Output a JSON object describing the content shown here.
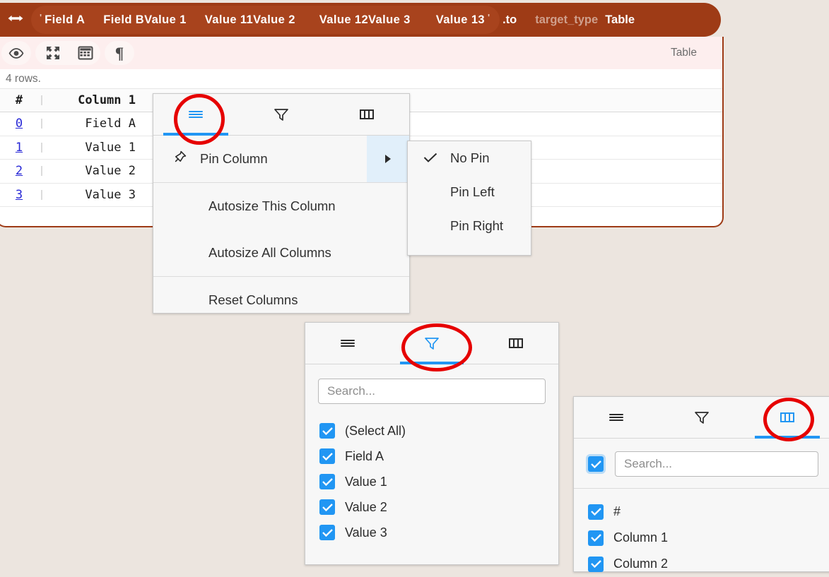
{
  "topbar": {
    "arrow_icon": "left-right-arrow-icon",
    "quote_open": "'",
    "quote_close": "'",
    "tokens": [
      "Field A",
      "Field B",
      "Value 1",
      "Value 11",
      "Value 2",
      "Value 12",
      "Value 3",
      "Value 13"
    ],
    "to_label": ".to",
    "param_name": "target_type",
    "param_value": "Table"
  },
  "toolbar": {
    "eye_icon": "eye-icon",
    "expand_icon": "expand-arrows-icon",
    "grid_icon": "table-grid-icon",
    "pilcrow_icon": "pilcrow-icon",
    "right_label": "Table"
  },
  "table": {
    "row_count_label": "4 rows.",
    "headers": [
      "#",
      "Column 1"
    ],
    "rows": [
      {
        "index": "0",
        "column1": "Field A"
      },
      {
        "index": "1",
        "column1": "Value 1"
      },
      {
        "index": "2",
        "column1": "Value 2"
      },
      {
        "index": "3",
        "column1": "Value 3"
      }
    ]
  },
  "menu_panel": {
    "tabs": [
      {
        "icon": "hamburger-menu-icon",
        "name": "general",
        "active": true
      },
      {
        "icon": "filter-funnel-icon",
        "name": "filter",
        "active": false
      },
      {
        "icon": "columns-icon",
        "name": "columns",
        "active": false
      }
    ],
    "items": [
      {
        "label": "Pin Column",
        "icon": "pin-icon",
        "has_submenu": true
      },
      {
        "label": "Autosize This Column",
        "icon": "",
        "has_submenu": false
      },
      {
        "label": "Autosize All Columns",
        "icon": "",
        "has_submenu": false
      },
      {
        "label": "Reset Columns",
        "icon": "",
        "has_submenu": false
      }
    ]
  },
  "pin_submenu": {
    "items": [
      {
        "label": "No Pin",
        "checked": true
      },
      {
        "label": "Pin Left",
        "checked": false
      },
      {
        "label": "Pin Right",
        "checked": false
      }
    ]
  },
  "filter_panel": {
    "tabs": [
      {
        "icon": "hamburger-menu-icon",
        "name": "general",
        "active": false
      },
      {
        "icon": "filter-funnel-icon",
        "name": "filter",
        "active": true
      },
      {
        "icon": "columns-icon",
        "name": "columns",
        "active": false
      }
    ],
    "search_placeholder": "Search...",
    "options": [
      {
        "label": "(Select All)",
        "checked": true
      },
      {
        "label": "Field A",
        "checked": true
      },
      {
        "label": "Value 1",
        "checked": true
      },
      {
        "label": "Value 2",
        "checked": true
      },
      {
        "label": "Value 3",
        "checked": true
      }
    ]
  },
  "columns_panel": {
    "tabs": [
      {
        "icon": "hamburger-menu-icon",
        "name": "general",
        "active": false
      },
      {
        "icon": "filter-funnel-icon",
        "name": "filter",
        "active": false
      },
      {
        "icon": "columns-icon",
        "name": "columns",
        "active": true
      }
    ],
    "select_all_checked": true,
    "search_placeholder": "Search...",
    "options": [
      {
        "label": "#",
        "checked": true
      },
      {
        "label": "Column 1",
        "checked": true
      },
      {
        "label": "Column 2",
        "checked": true
      }
    ]
  },
  "colors": {
    "brand_brown": "#9e3b16",
    "accent_blue": "#2196f3",
    "annotation_red": "#e60000",
    "link_blue": "#2727d6",
    "page_bg": "#ece5df"
  }
}
